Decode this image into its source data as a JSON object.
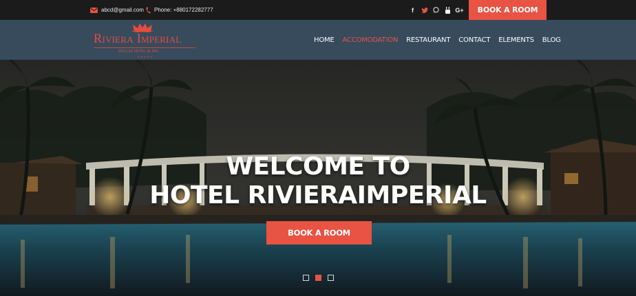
{
  "topbar": {
    "email": "abcd@gmail.com",
    "phone": "Phone: +880172282777",
    "social_icons": [
      "facebook-icon",
      "twitter-icon",
      "whatsapp-icon",
      "youtube-icon",
      "google-plus-icon"
    ],
    "book_label": "BOOK A ROOM"
  },
  "logo": {
    "name": "Riviera Imperial",
    "tagline": "Deluxe Hotel & Spa",
    "stars": "★★★★★"
  },
  "nav": {
    "items": [
      {
        "label": "HOME"
      },
      {
        "label": "ACCOMODATION",
        "active": true
      },
      {
        "label": "RESTAURANT"
      },
      {
        "label": "CONTACT"
      },
      {
        "label": "ELEMENTS"
      },
      {
        "label": "BLOG"
      }
    ]
  },
  "hero": {
    "line1": "WELCOME TO",
    "line2": "HOTEL RIVIERAIMPERIAL",
    "button": "BOOK A ROOM",
    "slides": 3,
    "active_slide": 2
  },
  "colors": {
    "accent": "#e85343",
    "topbar": "#1b1b1b",
    "navbar": "#374b5d"
  }
}
